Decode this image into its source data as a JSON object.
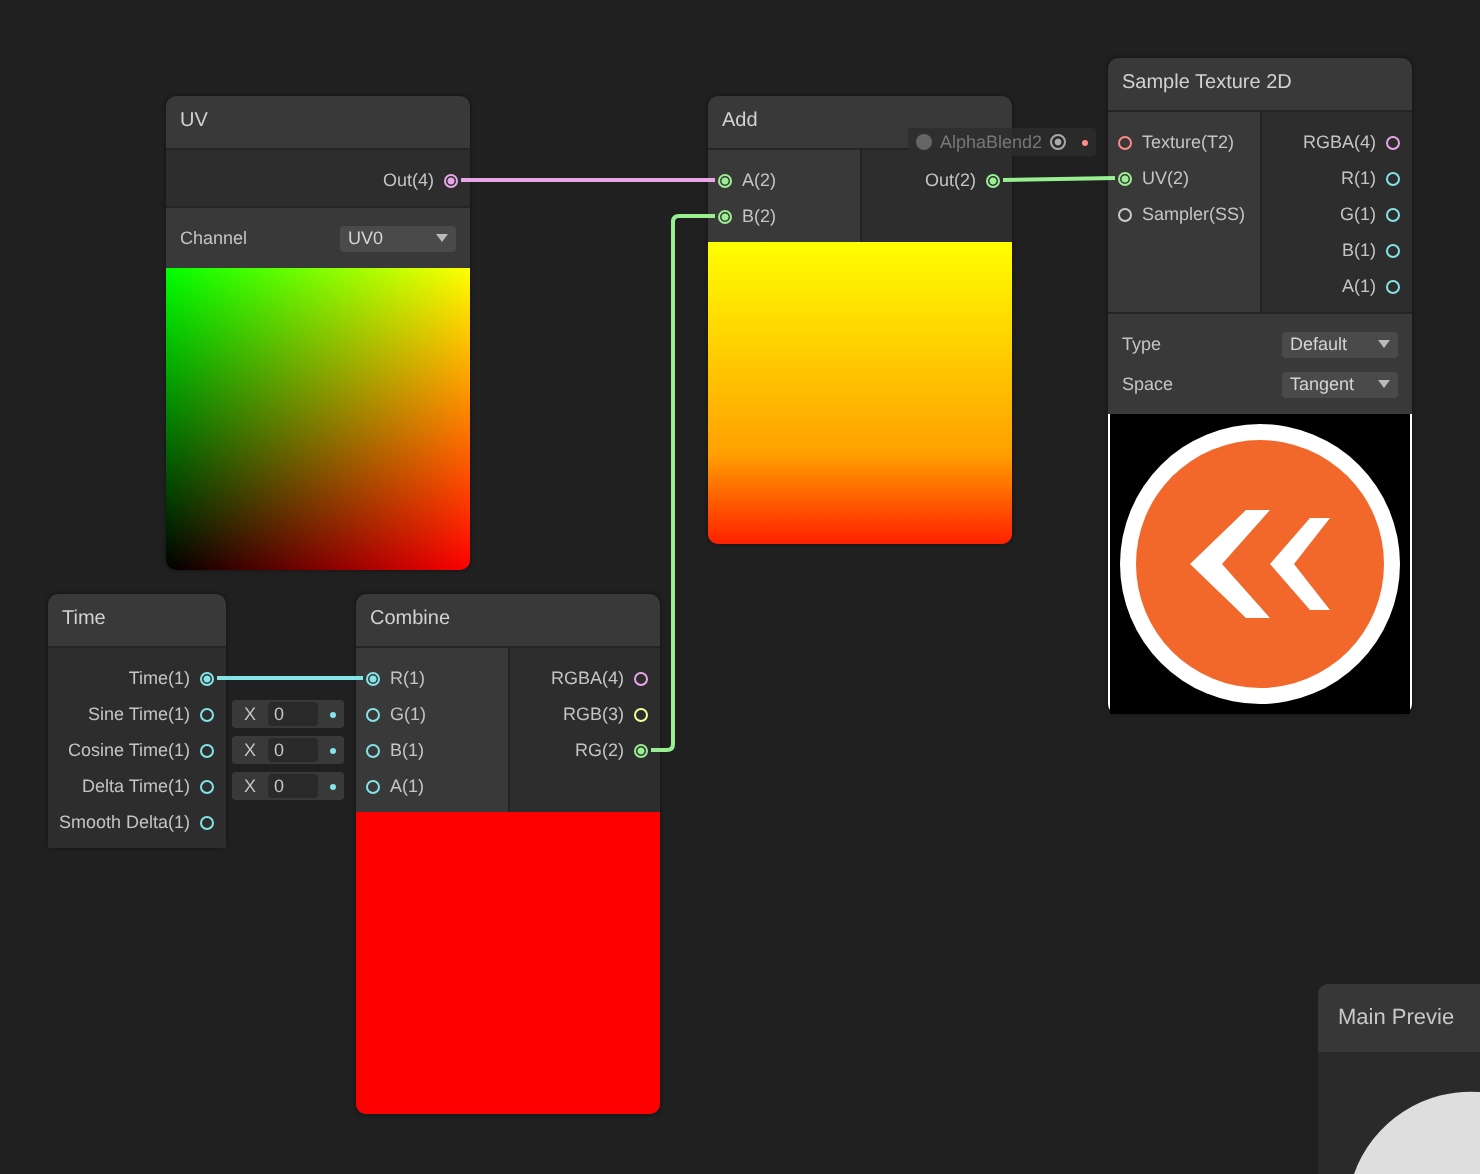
{
  "nodes": [
    {
      "title": "UV",
      "outputs": [
        {
          "label": "Out(4)",
          "color": "#e8a6e8",
          "connected": true
        }
      ],
      "settings": [
        {
          "label": "Channel",
          "value": "UV0"
        }
      ],
      "preview": {
        "kind": "uv"
      }
    },
    {
      "title": "Add",
      "inputs": [
        {
          "label": "A(2)",
          "color": "#9aef92",
          "connected": true
        },
        {
          "label": "B(2)",
          "color": "#9aef92",
          "connected": true
        }
      ],
      "outputs": [
        {
          "label": "Out(2)",
          "color": "#9aef92",
          "connected": true
        }
      ],
      "preview": {
        "kind": "gradient"
      }
    },
    {
      "title": "Sample Texture 2D",
      "inputs": [
        {
          "label": "Texture(T2)",
          "color": "#ff8b8b",
          "connected": false,
          "default": {
            "kind": "texture",
            "value": "AlphaBlend2"
          }
        },
        {
          "label": "UV(2)",
          "color": "#9aef92",
          "connected": true
        },
        {
          "label": "Sampler(SS)",
          "color": "#cccccc",
          "connected": false
        }
      ],
      "outputs": [
        {
          "label": "RGBA(4)",
          "color": "#e8a6e8",
          "connected": false
        },
        {
          "label": "R(1)",
          "color": "#84e4e7",
          "connected": false
        },
        {
          "label": "G(1)",
          "color": "#84e4e7",
          "connected": false
        },
        {
          "label": "B(1)",
          "color": "#84e4e7",
          "connected": false
        },
        {
          "label": "A(1)",
          "color": "#84e4e7",
          "connected": false
        }
      ],
      "settings": [
        {
          "label": "Type",
          "value": "Default"
        },
        {
          "label": "Space",
          "value": "Tangent"
        }
      ],
      "preview": {
        "kind": "texture"
      }
    },
    {
      "title": "Time",
      "outputs": [
        {
          "label": "Time(1)",
          "color": "#84e4e7",
          "connected": true
        },
        {
          "label": "Sine Time(1)",
          "color": "#84e4e7",
          "connected": false
        },
        {
          "label": "Cosine Time(1)",
          "color": "#84e4e7",
          "connected": false
        },
        {
          "label": "Delta Time(1)",
          "color": "#84e4e7",
          "connected": false
        },
        {
          "label": "Smooth Delta(1)",
          "color": "#84e4e7",
          "connected": false
        }
      ]
    },
    {
      "title": "Combine",
      "inputs": [
        {
          "label": "R(1)",
          "color": "#84e4e7",
          "connected": true
        },
        {
          "label": "G(1)",
          "color": "#84e4e7",
          "connected": false,
          "default": {
            "kind": "vector",
            "axis": "X",
            "value": "0"
          }
        },
        {
          "label": "B(1)",
          "color": "#84e4e7",
          "connected": false,
          "default": {
            "kind": "vector",
            "axis": "X",
            "value": "0"
          }
        },
        {
          "label": "A(1)",
          "color": "#84e4e7",
          "connected": false,
          "default": {
            "kind": "vector",
            "axis": "X",
            "value": "0"
          }
        }
      ],
      "outputs": [
        {
          "label": "RGBA(4)",
          "color": "#e8a6e8",
          "connected": false
        },
        {
          "label": "RGB(3)",
          "color": "#f6ff9a",
          "connected": false
        },
        {
          "label": "RG(2)",
          "color": "#9aef92",
          "connected": true
        }
      ],
      "preview": {
        "kind": "solid",
        "color": "#ff0000"
      }
    }
  ],
  "main_preview": {
    "title": "Main Previe"
  }
}
